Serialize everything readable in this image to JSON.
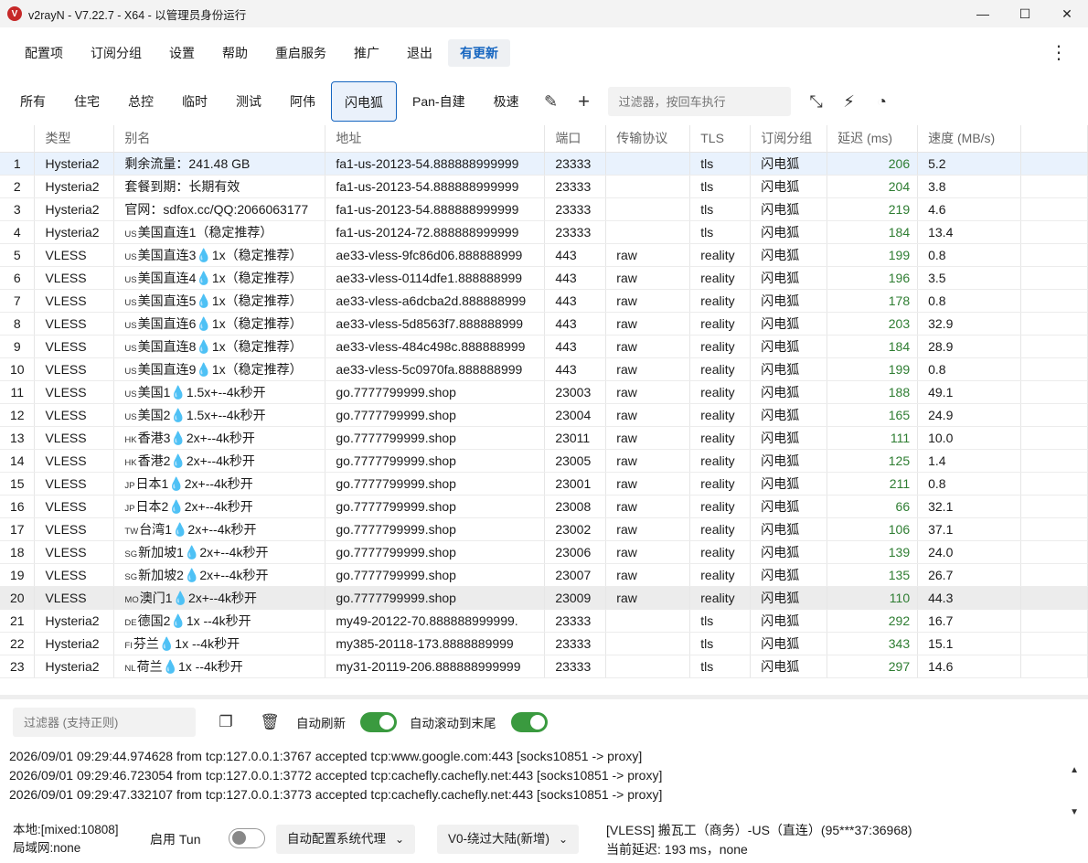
{
  "window": {
    "title": "v2rayN - V7.22.7 - X64 - 以管理员身份运行",
    "minimize": "—",
    "maximize": "☐",
    "close": "✕"
  },
  "menu": [
    "配置项",
    "订阅分组",
    "设置",
    "帮助",
    "重启服务",
    "推广",
    "退出"
  ],
  "menu_update": "有更新",
  "tabs": [
    "所有",
    "住宅",
    "总控",
    "临时",
    "测试",
    "阿伟",
    "闪电狐",
    "Pan-自建",
    "极速"
  ],
  "active_tab": "闪电狐",
  "filter_placeholder": "过滤器，按回车执行",
  "columns": [
    "",
    "类型",
    "别名",
    "地址",
    "端口",
    "传输协议",
    "TLS",
    "订阅分组",
    "延迟 (ms)",
    "速度 (MB/s)"
  ],
  "rows": [
    {
      "n": "1",
      "type": "Hysteria2",
      "cc": "",
      "alias": "剩余流量：241.48 GB",
      "addr": "fa1-us-20123-54.888888999999",
      "port": "23333",
      "net": "",
      "tls": "tls",
      "group": "闪电狐",
      "delay": "206",
      "speed": "5.2"
    },
    {
      "n": "2",
      "type": "Hysteria2",
      "cc": "",
      "alias": "套餐到期：长期有效",
      "addr": "fa1-us-20123-54.888888999999",
      "port": "23333",
      "net": "",
      "tls": "tls",
      "group": "闪电狐",
      "delay": "204",
      "speed": "3.8"
    },
    {
      "n": "3",
      "type": "Hysteria2",
      "cc": "",
      "alias": "官网：sdfox.cc/QQ:2066063177",
      "addr": "fa1-us-20123-54.888888999999",
      "port": "23333",
      "net": "",
      "tls": "tls",
      "group": "闪电狐",
      "delay": "219",
      "speed": "4.6"
    },
    {
      "n": "4",
      "type": "Hysteria2",
      "cc": "US",
      "alias": "美国直连1（稳定推荐）",
      "addr": "fa1-us-20124-72.888888999999",
      "port": "23333",
      "net": "",
      "tls": "tls",
      "group": "闪电狐",
      "delay": "184",
      "speed": "13.4"
    },
    {
      "n": "5",
      "type": "VLESS",
      "cc": "US",
      "alias": "美国直连3💧1x（稳定推荐）",
      "addr": "ae33-vless-9fc86d06.888888999",
      "port": "443",
      "net": "raw",
      "tls": "reality",
      "group": "闪电狐",
      "delay": "199",
      "speed": "0.8"
    },
    {
      "n": "6",
      "type": "VLESS",
      "cc": "US",
      "alias": "美国直连4💧1x（稳定推荐）",
      "addr": "ae33-vless-0114dfe1.888888999",
      "port": "443",
      "net": "raw",
      "tls": "reality",
      "group": "闪电狐",
      "delay": "196",
      "speed": "3.5"
    },
    {
      "n": "7",
      "type": "VLESS",
      "cc": "US",
      "alias": "美国直连5💧1x（稳定推荐）",
      "addr": "ae33-vless-a6dcba2d.888888999",
      "port": "443",
      "net": "raw",
      "tls": "reality",
      "group": "闪电狐",
      "delay": "178",
      "speed": "0.8"
    },
    {
      "n": "8",
      "type": "VLESS",
      "cc": "US",
      "alias": "美国直连6💧1x（稳定推荐）",
      "addr": "ae33-vless-5d8563f7.888888999",
      "port": "443",
      "net": "raw",
      "tls": "reality",
      "group": "闪电狐",
      "delay": "203",
      "speed": "32.9"
    },
    {
      "n": "9",
      "type": "VLESS",
      "cc": "US",
      "alias": "美国直连8💧1x（稳定推荐）",
      "addr": "ae33-vless-484c498c.888888999",
      "port": "443",
      "net": "raw",
      "tls": "reality",
      "group": "闪电狐",
      "delay": "184",
      "speed": "28.9"
    },
    {
      "n": "10",
      "type": "VLESS",
      "cc": "US",
      "alias": "美国直连9💧1x（稳定推荐）",
      "addr": "ae33-vless-5c0970fa.888888999",
      "port": "443",
      "net": "raw",
      "tls": "reality",
      "group": "闪电狐",
      "delay": "199",
      "speed": "0.8"
    },
    {
      "n": "11",
      "type": "VLESS",
      "cc": "US",
      "alias": "美国1💧1.5x+--4k秒开",
      "addr": "go.7777799999.shop",
      "port": "23003",
      "net": "raw",
      "tls": "reality",
      "group": "闪电狐",
      "delay": "188",
      "speed": "49.1"
    },
    {
      "n": "12",
      "type": "VLESS",
      "cc": "US",
      "alias": "美国2💧1.5x+--4k秒开",
      "addr": "go.7777799999.shop",
      "port": "23004",
      "net": "raw",
      "tls": "reality",
      "group": "闪电狐",
      "delay": "165",
      "speed": "24.9"
    },
    {
      "n": "13",
      "type": "VLESS",
      "cc": "HK",
      "alias": "香港3💧2x+--4k秒开",
      "addr": "go.7777799999.shop",
      "port": "23011",
      "net": "raw",
      "tls": "reality",
      "group": "闪电狐",
      "delay": "111",
      "speed": "10.0"
    },
    {
      "n": "14",
      "type": "VLESS",
      "cc": "HK",
      "alias": "香港2💧2x+--4k秒开",
      "addr": "go.7777799999.shop",
      "port": "23005",
      "net": "raw",
      "tls": "reality",
      "group": "闪电狐",
      "delay": "125",
      "speed": "1.4"
    },
    {
      "n": "15",
      "type": "VLESS",
      "cc": "JP",
      "alias": "日本1💧2x+--4k秒开",
      "addr": "go.7777799999.shop",
      "port": "23001",
      "net": "raw",
      "tls": "reality",
      "group": "闪电狐",
      "delay": "211",
      "speed": "0.8"
    },
    {
      "n": "16",
      "type": "VLESS",
      "cc": "JP",
      "alias": "日本2💧2x+--4k秒开",
      "addr": "go.7777799999.shop",
      "port": "23008",
      "net": "raw",
      "tls": "reality",
      "group": "闪电狐",
      "delay": "66",
      "speed": "32.1"
    },
    {
      "n": "17",
      "type": "VLESS",
      "cc": "TW",
      "alias": "台湾1💧2x+--4k秒开",
      "addr": "go.7777799999.shop",
      "port": "23002",
      "net": "raw",
      "tls": "reality",
      "group": "闪电狐",
      "delay": "106",
      "speed": "37.1"
    },
    {
      "n": "18",
      "type": "VLESS",
      "cc": "SG",
      "alias": "新加坡1💧2x+--4k秒开",
      "addr": "go.7777799999.shop",
      "port": "23006",
      "net": "raw",
      "tls": "reality",
      "group": "闪电狐",
      "delay": "139",
      "speed": "24.0"
    },
    {
      "n": "19",
      "type": "VLESS",
      "cc": "SG",
      "alias": "新加坡2💧2x+--4k秒开",
      "addr": "go.7777799999.shop",
      "port": "23007",
      "net": "raw",
      "tls": "reality",
      "group": "闪电狐",
      "delay": "135",
      "speed": "26.7"
    },
    {
      "n": "20",
      "type": "VLESS",
      "cc": "MO",
      "alias": "澳门1💧2x+--4k秒开",
      "addr": "go.7777799999.shop",
      "port": "23009",
      "net": "raw",
      "tls": "reality",
      "group": "闪电狐",
      "delay": "110",
      "speed": "44.3"
    },
    {
      "n": "21",
      "type": "Hysteria2",
      "cc": "DE",
      "alias": "德国2💧1x --4k秒开",
      "addr": "my49-20122-70.888888999999.",
      "port": "23333",
      "net": "",
      "tls": "tls",
      "group": "闪电狐",
      "delay": "292",
      "speed": "16.7"
    },
    {
      "n": "22",
      "type": "Hysteria2",
      "cc": "FI",
      "alias": "芬兰💧1x --4k秒开",
      "addr": "my385-20118-173.8888889999",
      "port": "23333",
      "net": "",
      "tls": "tls",
      "group": "闪电狐",
      "delay": "343",
      "speed": "15.1"
    },
    {
      "n": "23",
      "type": "Hysteria2",
      "cc": "NL",
      "alias": "荷兰💧1x --4k秒开",
      "addr": "my31-20119-206.888888999999",
      "port": "23333",
      "net": "",
      "tls": "tls",
      "group": "闪电狐",
      "delay": "297",
      "speed": "14.6"
    }
  ],
  "log_filter_placeholder": "过滤器 (支持正则)",
  "auto_refresh_label": "自动刷新",
  "auto_scroll_label": "自动滚动到末尾",
  "logs": [
    "2026/09/01 09:29:44.974628 from tcp:127.0.0.1:3767 accepted tcp:www.google.com:443 [socks10851 -> proxy]",
    "2026/09/01 09:29:46.723054 from tcp:127.0.0.1:3772 accepted tcp:cachefly.cachefly.net:443 [socks10851 -> proxy]",
    "2026/09/01 09:29:47.332107 from tcp:127.0.0.1:3773 accepted tcp:cachefly.cachefly.net:443 [socks10851 -> proxy]"
  ],
  "status": {
    "local": "本地:[mixed:10808]",
    "lan": "局域网:none",
    "tun_label": "启用 Tun",
    "sysproxy": "自动配置系统代理",
    "routing": "V0-绕过大陆(新增)",
    "server": "[VLESS] 搬瓦工（商务）-US（直连）(95***37:36968)",
    "latency": "当前延迟: 193 ms，none"
  },
  "colors": {
    "accent": "#1565c0",
    "delay": "#2e7d32",
    "toggle_on": "#3a9a3f"
  }
}
